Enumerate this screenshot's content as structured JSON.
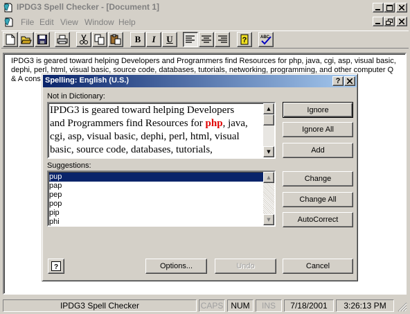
{
  "window": {
    "title": "IPDG3 Spell Checker - [Document 1]",
    "menu": [
      "File",
      "Edit",
      "View",
      "Window",
      "Help"
    ]
  },
  "toolbar": {
    "bold": "B",
    "italic": "I",
    "underline": "U"
  },
  "document": {
    "lines": [
      "IPDG3 is geared toward helping Developers and Programmers find Resources for php, java, cgi, asp, visual basic,",
      "dephi, perl, html, visual basic, source code, databases, tutorials, networking, programming, and other computer Q",
      "& A cons"
    ]
  },
  "dialog": {
    "title": "Spelling: English (U.S.)",
    "not_in_dictionary_label": "Not in Dictionary:",
    "not_in_dictionary_lines": [
      {
        "before": "IPDG3 is geared toward helping Developers",
        "word": "",
        "after": ""
      },
      {
        "before": "and Programmers find Resources for ",
        "word": "php",
        "after": ", java,"
      },
      {
        "before": "cgi, asp, visual basic, dephi, perl, html, visual",
        "word": "",
        "after": ""
      },
      {
        "before": "basic, source code, databases, tutorials,",
        "word": "",
        "after": ""
      }
    ],
    "suggestions_label": "Suggestions:",
    "suggestions": [
      "pup",
      "pap",
      "pep",
      "pop",
      "pip",
      "phi"
    ],
    "selected_suggestion": "pup",
    "buttons": {
      "ignore": "Ignore",
      "ignore_all": "Ignore All",
      "add": "Add",
      "change": "Change",
      "change_all": "Change All",
      "autocorrect": "AutoCorrect",
      "options": "Options...",
      "undo": "Undo",
      "cancel": "Cancel"
    }
  },
  "statusbar": {
    "app": "IPDG3 Spell Checker",
    "caps": "CAPS",
    "num": "NUM",
    "ins": "INS",
    "date": "7/18/2001",
    "time": "3:26:13 PM"
  },
  "colors": {
    "face": "#d4d0c8",
    "title_active_start": "#0a246a",
    "title_active_end": "#a6caf0",
    "selection": "#0a246a",
    "misspelled": "#e00000"
  }
}
